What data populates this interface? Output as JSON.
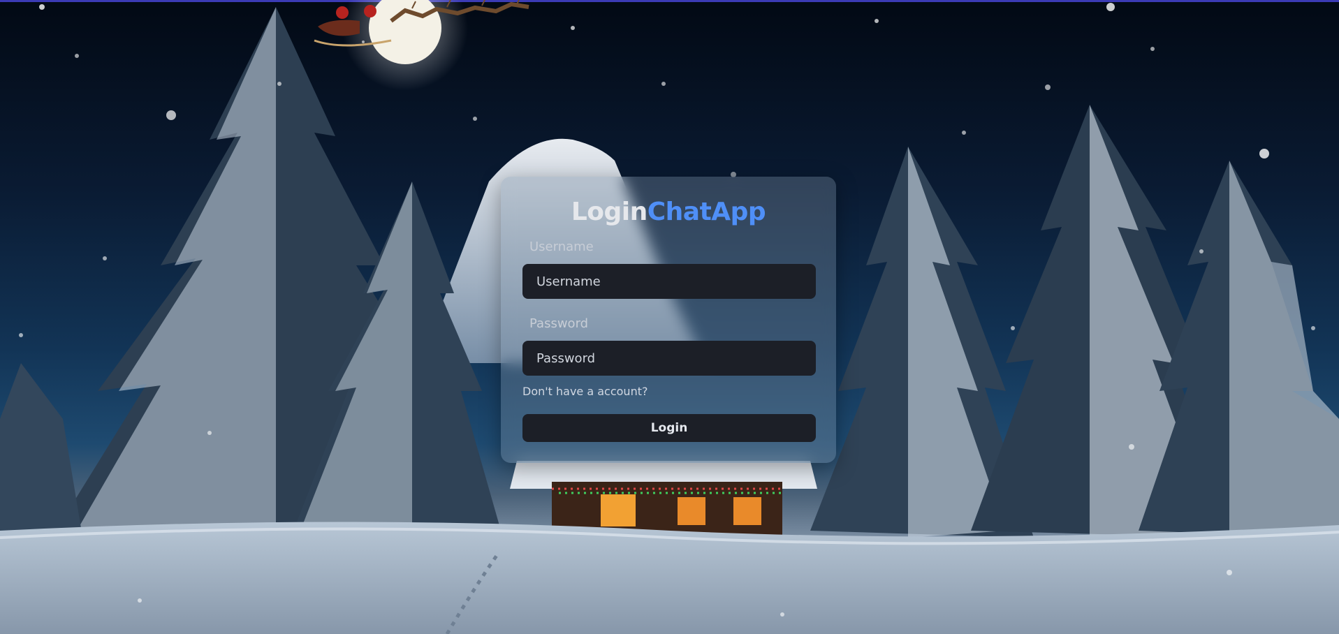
{
  "title": {
    "part1": "Login",
    "part2": "ChatApp",
    "accent_color": "#4f8ff7"
  },
  "form": {
    "username_label": "Username",
    "username_placeholder": "Username",
    "password_label": "Password",
    "password_placeholder": "Password",
    "signup_link": "Don't have a account?",
    "login_button": "Login"
  },
  "background": {
    "theme": "snowy-night-winter-scene",
    "elements": [
      "moon-icon",
      "santa-sleigh-icon",
      "snow-trees",
      "mountain",
      "cabin-with-lights",
      "snowfall"
    ]
  }
}
